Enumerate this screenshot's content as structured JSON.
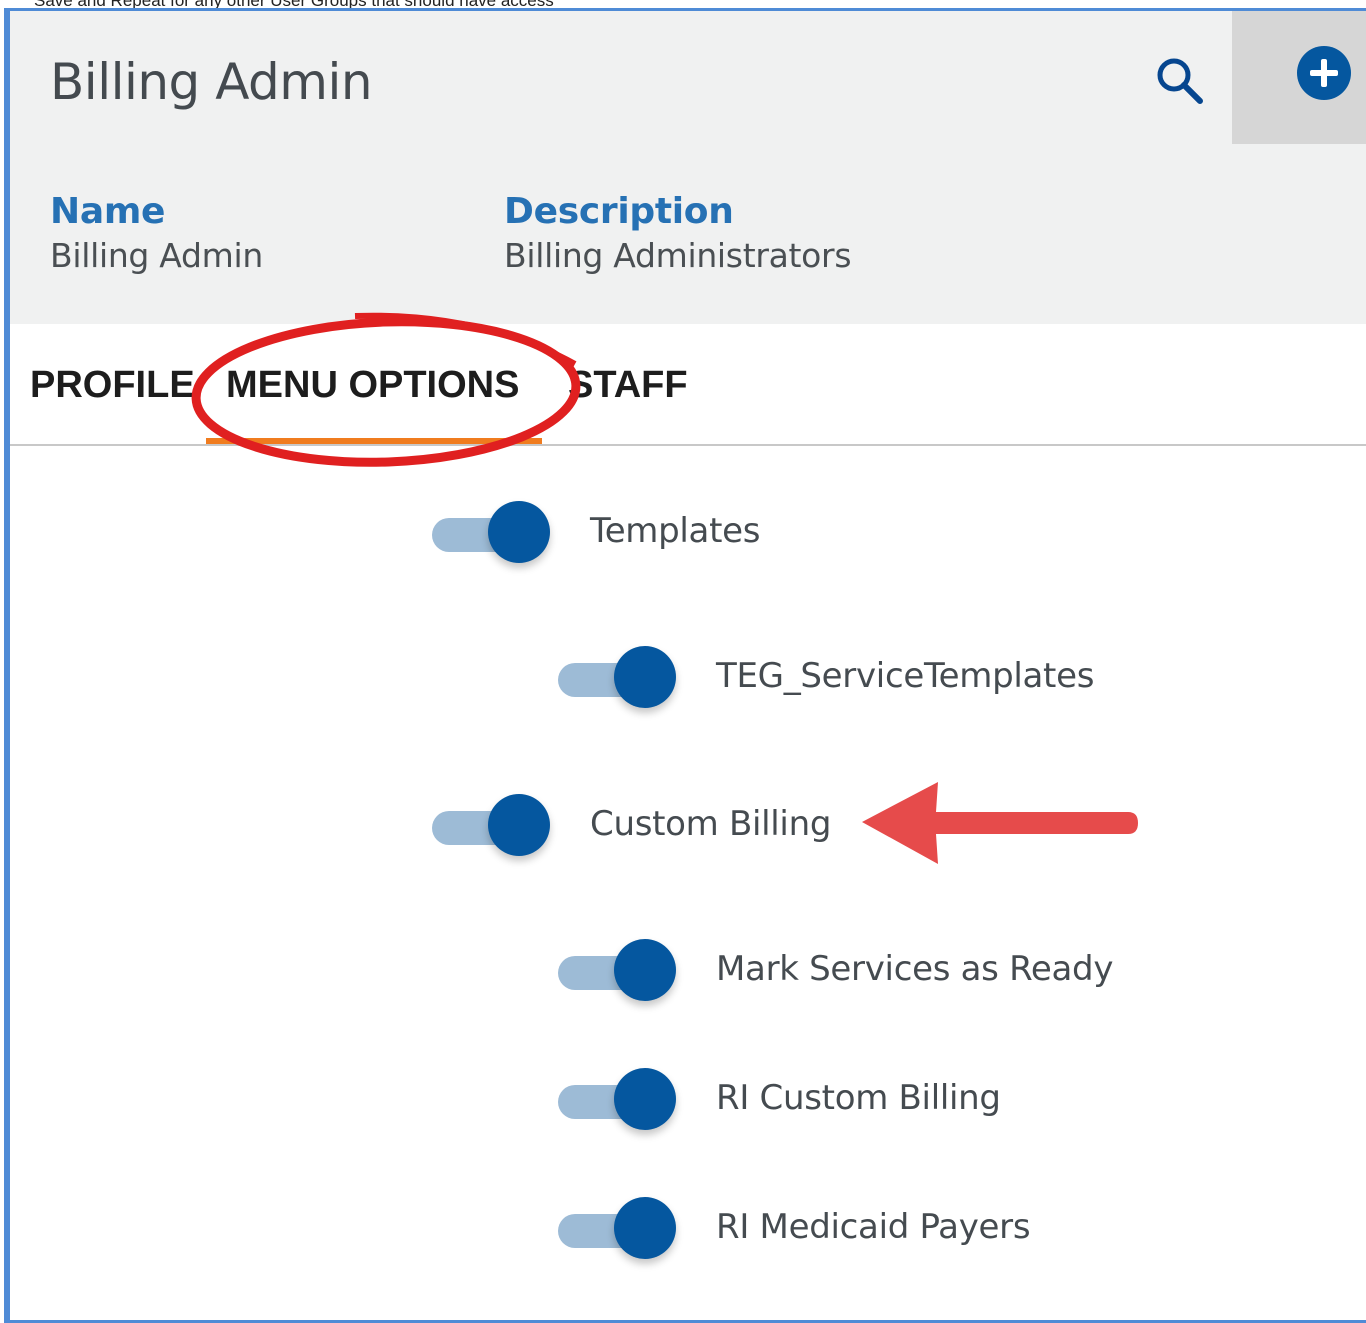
{
  "caption": "Save and Repeat for any other User Groups that should have access",
  "header": {
    "title": "Billing Admin",
    "name_label": "Name",
    "name_value": "Billing Admin",
    "description_label": "Description",
    "description_value": "Billing Administrators",
    "search_icon": "search-icon",
    "add_icon": "add-circle-icon"
  },
  "tabs": [
    {
      "label": "PROFILE"
    },
    {
      "label": "MENU OPTIONS",
      "active": true
    },
    {
      "label": "STAFF"
    }
  ],
  "menu_options": [
    {
      "label": "Templates",
      "enabled": true,
      "level": 0
    },
    {
      "label": "TEG_ServiceTemplates",
      "enabled": true,
      "level": 1
    },
    {
      "label": "Custom Billing",
      "enabled": true,
      "level": 0
    },
    {
      "label": "Mark Services as Ready",
      "enabled": true,
      "level": 1
    },
    {
      "label": "RI Custom Billing",
      "enabled": true,
      "level": 1
    },
    {
      "label": "RI Medicaid Payers",
      "enabled": true,
      "level": 1
    }
  ],
  "colors": {
    "accent_blue": "#05579f",
    "label_blue": "#2671b4",
    "tab_underline": "#f07c1f",
    "annotation_red": "#e02020",
    "arrow_red": "#e64b4b",
    "frame_blue": "#4f8bd6"
  }
}
